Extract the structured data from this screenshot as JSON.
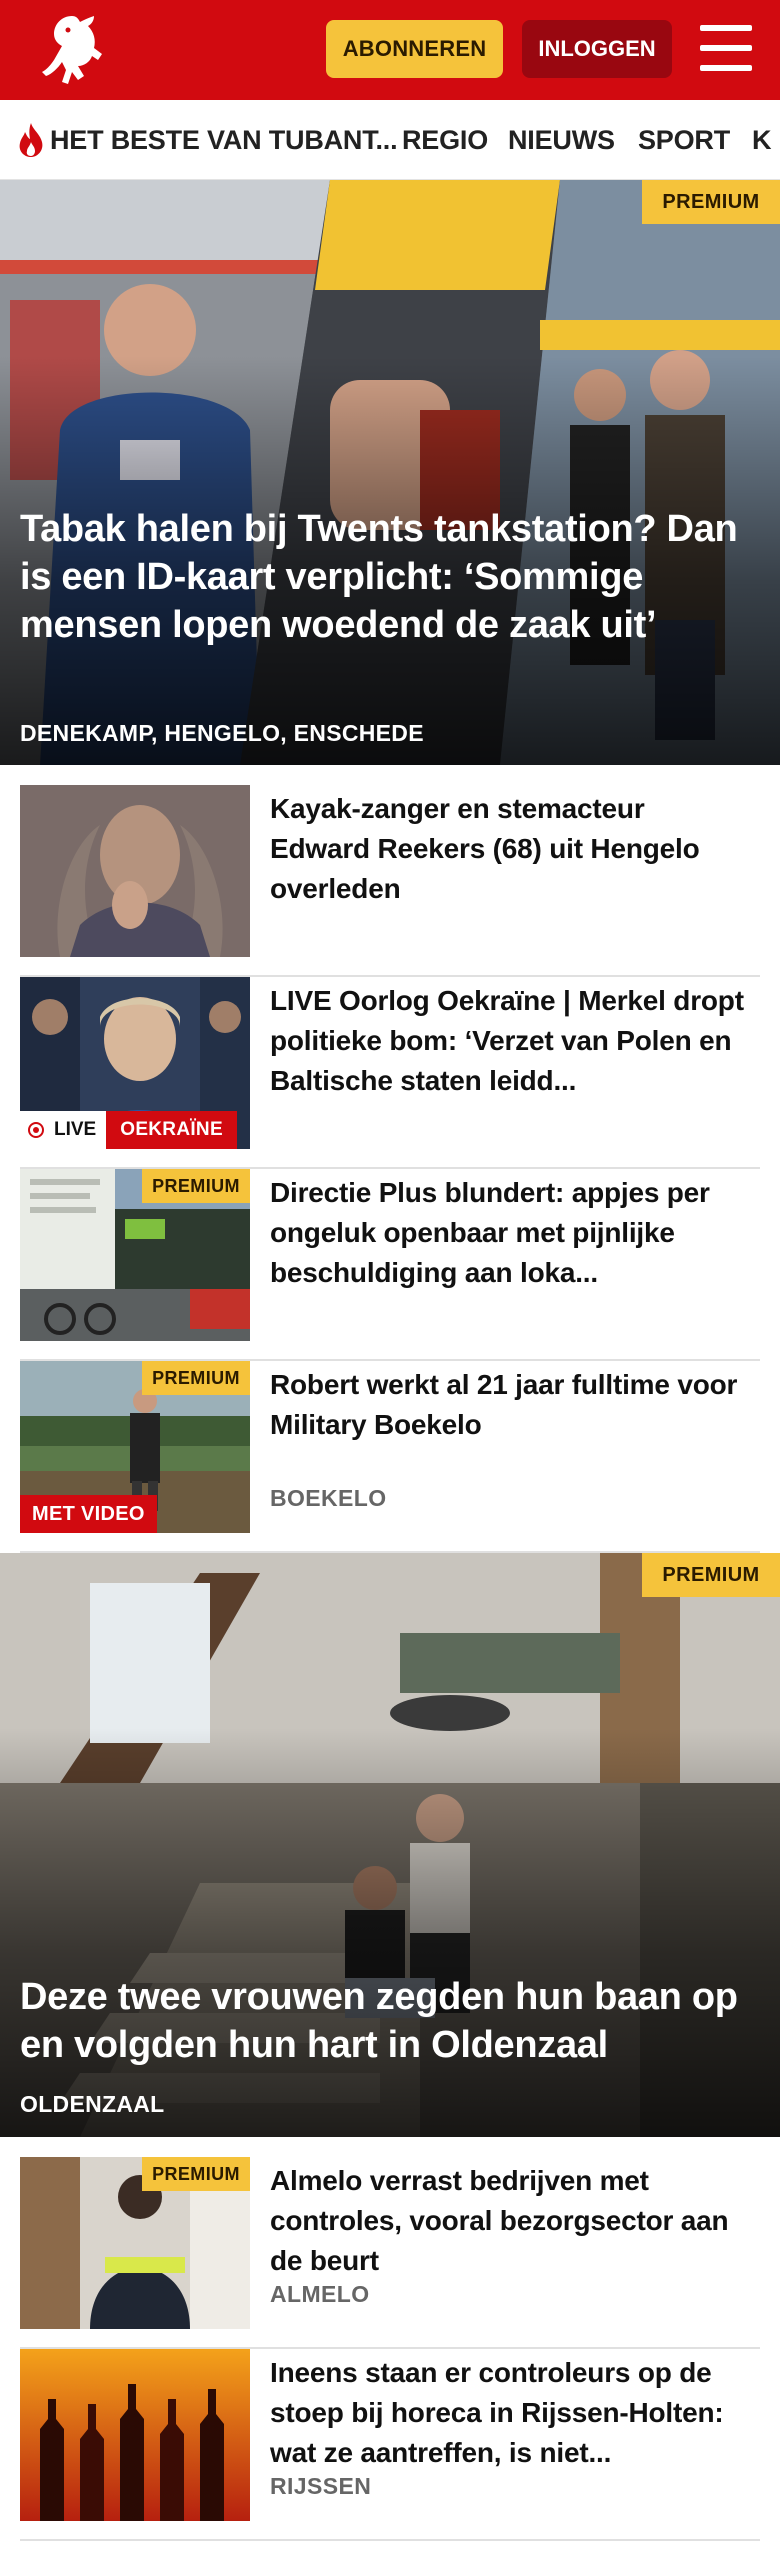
{
  "header": {
    "subscribe_label": "ABONNEREN",
    "login_label": "INLOGGEN",
    "brand_color": "#d10a10",
    "accent_color": "#f5c33b"
  },
  "nav": {
    "items": [
      {
        "label": "HET BESTE VAN TUBANT..."
      },
      {
        "label": "REGIO"
      },
      {
        "label": "NIEUWS"
      },
      {
        "label": "SPORT"
      },
      {
        "label": "K"
      }
    ]
  },
  "badges": {
    "premium": "PREMIUM",
    "live": "LIVE",
    "video": "MET VIDEO"
  },
  "hero1": {
    "title": "Tabak halen bij Twents tankstation? Dan is een ID-kaart verplicht: ‘Sommige mensen lopen woedend de zaak uit’",
    "location": "DENEKAMP, HENGELO, ENSCHEDE"
  },
  "articles": [
    {
      "title": "Kayak-zanger en stemacteur Edward Reekers (68) uit Hengelo overleden",
      "location": ""
    },
    {
      "title": "LIVE Oorlog Oekraïne | Merkel dropt politieke bom: ‘Verzet van Polen en Baltische staten leidd...",
      "location": "",
      "topic": "OEKRAÏNE"
    },
    {
      "title": "Directie Plus blundert: appjes per ongeluk openbaar met pijnlijke beschuldiging aan loka...",
      "location": ""
    },
    {
      "title": "Robert werkt al 21 jaar fulltime voor Military Boekelo",
      "location": "BOEKELO"
    }
  ],
  "hero2": {
    "title": "Deze twee vrouwen zegden hun baan op en volgden hun hart in Oldenzaal",
    "location": "OLDENZAAL"
  },
  "articles2": [
    {
      "title": "Almelo verrast bedrijven met controles, vooral bezorgsector aan de beurt",
      "location": "ALMELO"
    },
    {
      "title": "Ineens staan er controleurs op de stoep bij horeca in Rijssen-Hol­ten: wat ze aantreffen, is niet...",
      "location": "RIJSSEN"
    }
  ]
}
